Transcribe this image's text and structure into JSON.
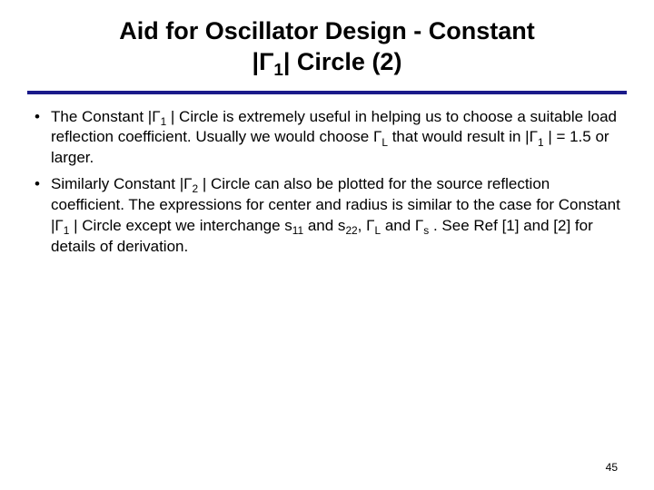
{
  "title": {
    "line1": "Aid for Oscillator Design - Constant",
    "line2_prefix": "|",
    "line2_gamma": "Γ",
    "line2_sub": "1",
    "line2_suffix": "| Circle (2)"
  },
  "bullets": [
    {
      "segments": [
        "The Constant |Γ",
        {
          "sub": "1"
        },
        " | Circle is extremely useful in helping us to choose a suitable load reflection coefficient.  Usually we would choose Γ",
        {
          "sub": "L"
        },
        " that would result in |Γ",
        {
          "sub": "1"
        },
        " | = 1.5 or larger."
      ]
    },
    {
      "segments": [
        "Similarly Constant |Γ",
        {
          "sub": "2"
        },
        " | Circle can also be plotted for the source reflection coefficient.  The expressions for center and radius is similar to the case for Constant |Γ",
        {
          "sub": "1"
        },
        " | Circle except we interchange s",
        {
          "sub": "11"
        },
        " and s",
        {
          "sub": "22"
        },
        ", Γ",
        {
          "sub": "L"
        },
        " and Γ",
        {
          "sub": "s"
        },
        " .  See Ref [1] and [2] for details of derivation."
      ]
    }
  ],
  "page_number": "45"
}
